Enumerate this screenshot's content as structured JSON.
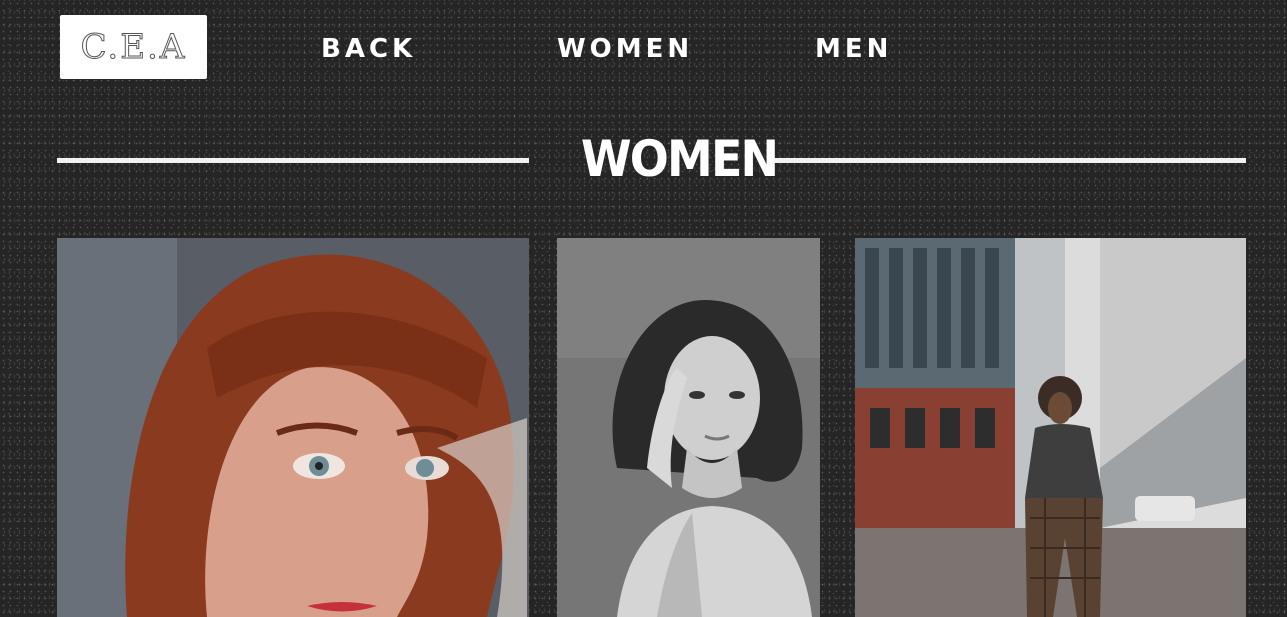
{
  "header": {
    "logo_text": "C.E.A",
    "nav": [
      {
        "label": "BACK"
      },
      {
        "label": "WOMEN"
      },
      {
        "label": "MEN"
      }
    ]
  },
  "section": {
    "title": "WOMEN"
  },
  "gallery": [
    {
      "subject": "portrait-red-hair",
      "colors": {
        "bg": "#585d66",
        "hair": "#8a3a1e",
        "skin": "#d8a08a"
      }
    },
    {
      "subject": "portrait-black-white",
      "colors": {
        "bg": "#6e6e6e",
        "hair": "#2a2a2a",
        "skin": "#cfcfcf"
      }
    },
    {
      "subject": "street-fashion",
      "colors": {
        "sky": "#d9d9d9",
        "building": "#8a3f33",
        "street": "#7c7470",
        "figure": "#4b3b30"
      }
    }
  ]
}
